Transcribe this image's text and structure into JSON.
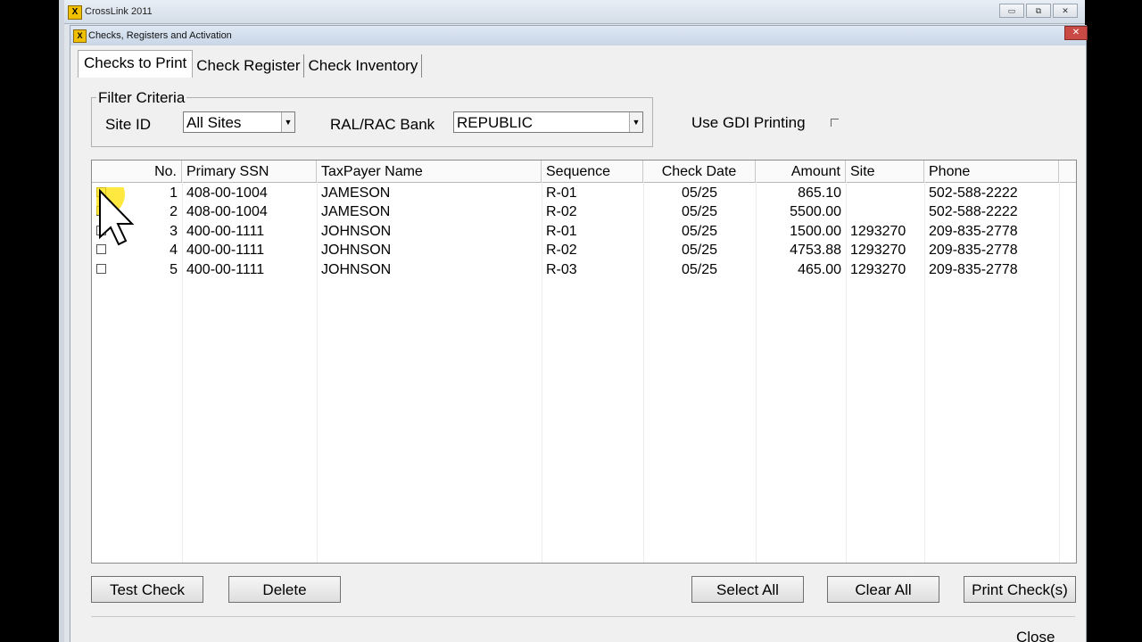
{
  "app": {
    "title": "CrossLink 2011",
    "icon_letter": "X"
  },
  "window_buttons": {
    "minimize": "▭",
    "restore": "⧉",
    "close": "✕"
  },
  "dialog": {
    "title": "Checks, Registers and Activation",
    "close": "✕"
  },
  "tabs": [
    {
      "label": "Checks to Print",
      "active": true
    },
    {
      "label": "Check Register",
      "active": false
    },
    {
      "label": "Check Inventory",
      "active": false
    }
  ],
  "filter": {
    "legend": "Filter Criteria",
    "site_id_label": "Site ID",
    "site_id_value": "All Sites",
    "bank_label": "RAL/RAC Bank",
    "bank_value": "REPUBLIC",
    "gdi_label": "Use GDI Printing"
  },
  "grid": {
    "columns": [
      "No.",
      "Primary SSN",
      "TaxPayer Name",
      "Sequence",
      "Check Date",
      "Amount",
      "Site",
      "Phone"
    ],
    "rows": [
      {
        "no": "1",
        "ssn": "408-00-1004",
        "name": "JAMESON",
        "seq": "R-01",
        "date": "05/25",
        "amount": "865.10",
        "site": "",
        "phone": "502-588-2222"
      },
      {
        "no": "2",
        "ssn": "408-00-1004",
        "name": "JAMESON",
        "seq": "R-02",
        "date": "05/25",
        "amount": "5500.00",
        "site": "",
        "phone": "502-588-2222"
      },
      {
        "no": "3",
        "ssn": "400-00-1111",
        "name": "JOHNSON",
        "seq": "R-01",
        "date": "05/25",
        "amount": "1500.00",
        "site": "1293270",
        "phone": "209-835-2778"
      },
      {
        "no": "4",
        "ssn": "400-00-1111",
        "name": "JOHNSON",
        "seq": "R-02",
        "date": "05/25",
        "amount": "4753.88",
        "site": "1293270",
        "phone": "209-835-2778"
      },
      {
        "no": "5",
        "ssn": "400-00-1111",
        "name": "JOHNSON",
        "seq": "R-03",
        "date": "05/25",
        "amount": "465.00",
        "site": "1293270",
        "phone": "209-835-2778"
      }
    ]
  },
  "buttons": {
    "test_check": "Test Check",
    "delete": "Delete",
    "select_all": "Select All",
    "clear_all": "Clear All",
    "print_checks": "Print Check(s)",
    "close": "Close"
  }
}
